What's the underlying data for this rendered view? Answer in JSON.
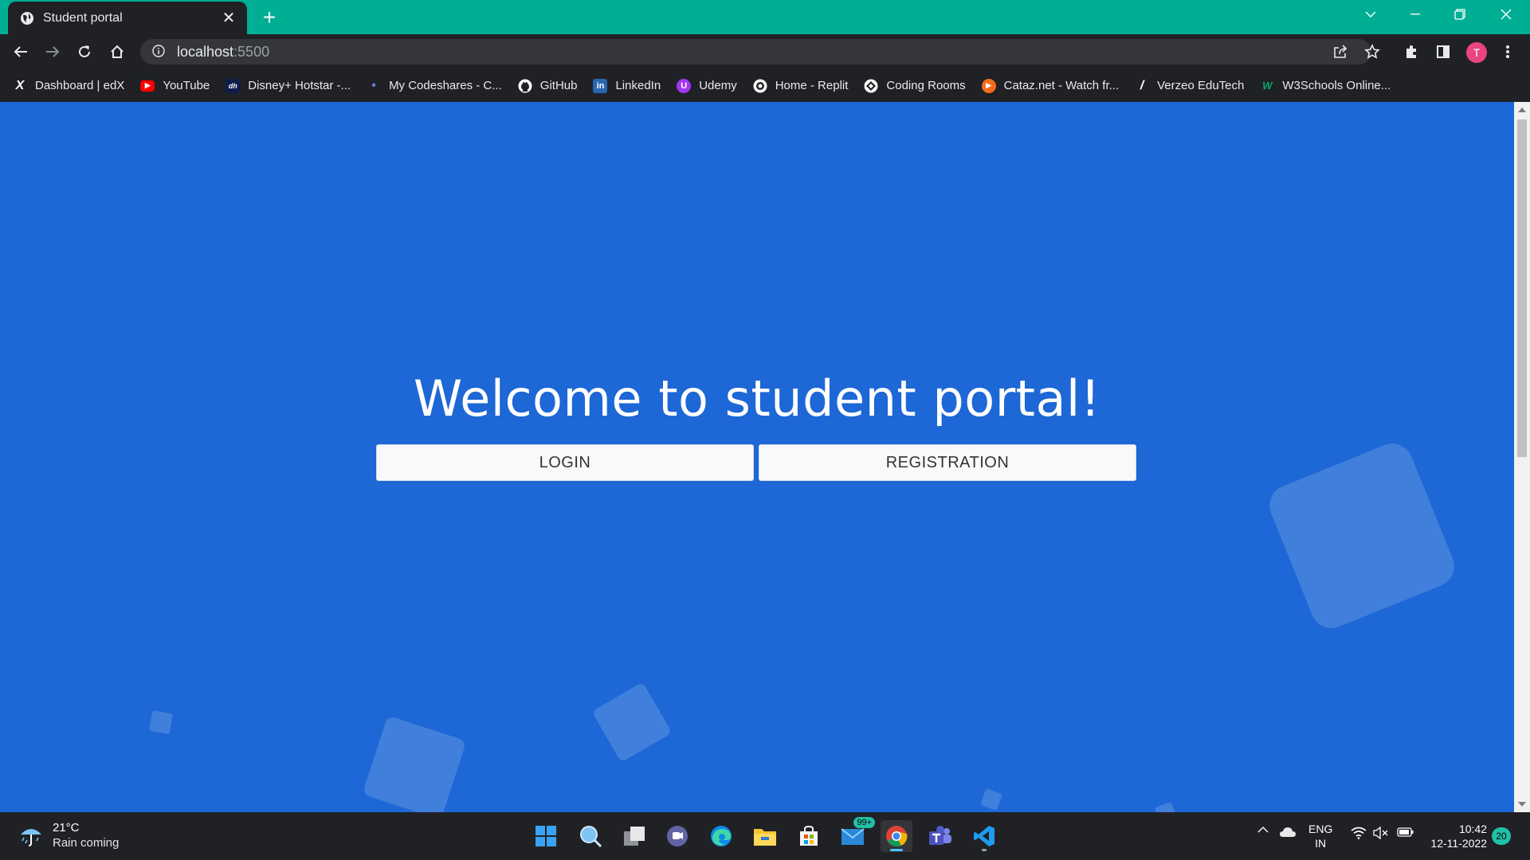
{
  "browser": {
    "tab": {
      "title": "Student portal",
      "close": "✕"
    },
    "new_tab": "+",
    "url": {
      "host": "localhost",
      "port": ":5500"
    },
    "profile_initial": "T",
    "colors": {
      "tabstrip": "#00ae94",
      "toolbar": "#202124",
      "avatar": "#e8457f"
    }
  },
  "bookmarks": [
    {
      "label": "Dashboard | edX",
      "icon": "edx-icon",
      "glyph": "X"
    },
    {
      "label": "YouTube",
      "icon": "youtube-icon",
      "glyph": "▶"
    },
    {
      "label": "Disney+ Hotstar -...",
      "icon": "hotstar-icon",
      "glyph": "dh"
    },
    {
      "label": "My Codeshares - C...",
      "icon": "codeshare-icon",
      "glyph": "•"
    },
    {
      "label": "GitHub",
      "icon": "github-icon",
      "glyph": ""
    },
    {
      "label": "LinkedIn",
      "icon": "linkedin-icon",
      "glyph": "in"
    },
    {
      "label": "Udemy",
      "icon": "udemy-icon",
      "glyph": "U"
    },
    {
      "label": "Home - Replit",
      "icon": "replit-icon",
      "glyph": ""
    },
    {
      "label": "Coding Rooms",
      "icon": "coding-rooms-icon",
      "glyph": ""
    },
    {
      "label": "Cataz.net - Watch fr...",
      "icon": "cataz-icon",
      "glyph": "▶"
    },
    {
      "label": "Verzeo EduTech",
      "icon": "verzeo-icon",
      "glyph": "/"
    },
    {
      "label": "W3Schools Online...",
      "icon": "w3schools-icon",
      "glyph": "W"
    }
  ],
  "page": {
    "heading": "Welcome to student portal!",
    "login_label": "LOGIN",
    "registration_label": "REGISTRATION",
    "background_color": "#1d67d6"
  },
  "taskbar": {
    "weather": {
      "temp": "21°C",
      "desc": "Rain coming"
    },
    "mail_badge": "99+",
    "language": {
      "line1": "ENG",
      "line2": "IN"
    },
    "clock": {
      "time": "10:42",
      "date": "12-11-2022"
    },
    "notification_count": "20"
  }
}
